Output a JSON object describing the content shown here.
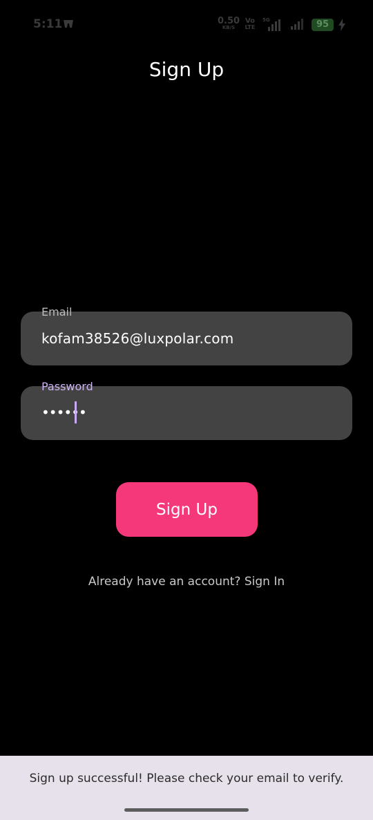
{
  "status_bar": {
    "time": "5:11",
    "net_speed_value": "0.50",
    "net_speed_unit": "KB/S",
    "volte_top": "Vo",
    "volte_bottom": "LTE",
    "network_type": "5G",
    "battery": "95",
    "icons": [
      "notification-icon",
      "signal-5g-icon",
      "signal-icon",
      "battery-icon",
      "charging-icon"
    ]
  },
  "header": {
    "title": "Sign Up"
  },
  "form": {
    "email_label": "Email",
    "email_value": "kofam38526@luxpolar.com",
    "password_label": "Password",
    "password_value": "••••••",
    "submit_label": "Sign Up",
    "signin_link": "Already have an account? Sign In"
  },
  "snackbar": {
    "message": "Sign up successful! Please check your email to verify."
  },
  "colors": {
    "background": "#000000",
    "field_background": "#434343",
    "accent": "#f5387a",
    "focus": "#c8a9f4",
    "snackbar_background": "#e6e1ea"
  }
}
